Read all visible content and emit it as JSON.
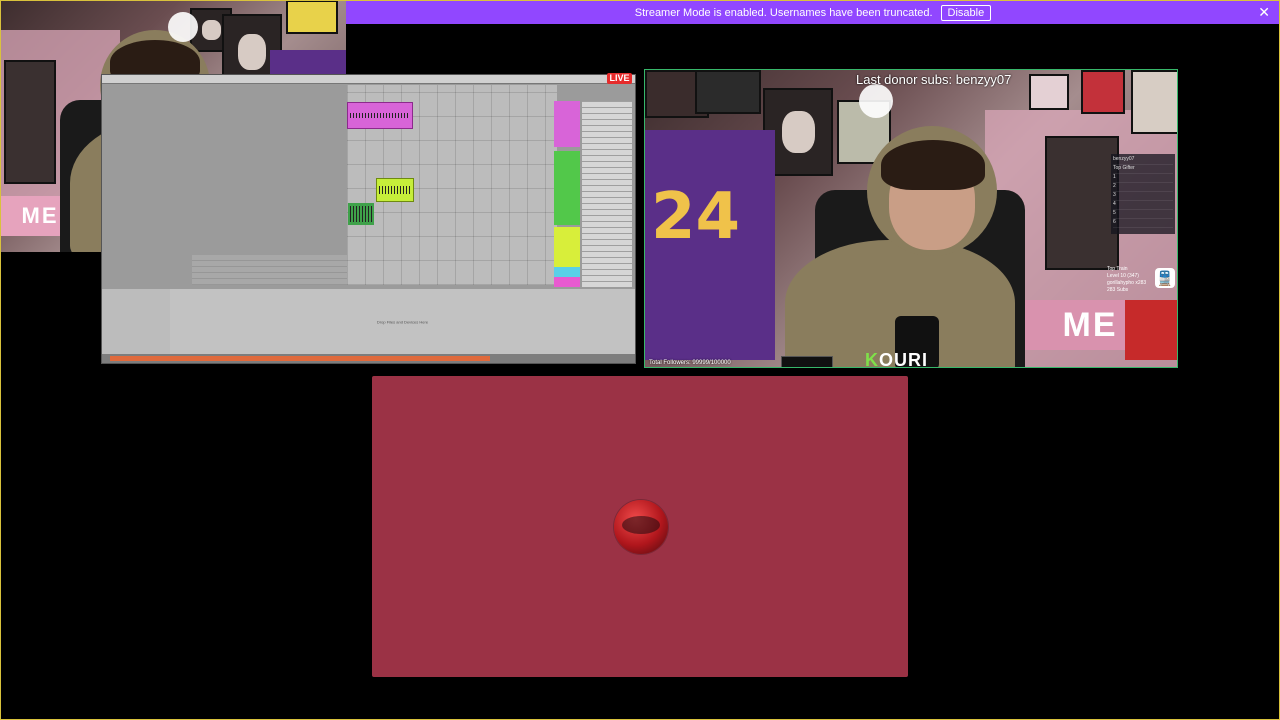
{
  "banner": {
    "message": "Streamer Mode is enabled. Usernames have been truncated.",
    "disable_label": "Disable",
    "close_icon": "✕"
  },
  "live_badge": "LIVE",
  "right_cam": {
    "donor_text": "Last donor subs: benzyy07",
    "brand_prefix": "K",
    "brand_rest": "OURI",
    "followers_text": "Total Followers: 99999/100000",
    "leaderboard_rows": [
      "benzyy07",
      "Top Gifter",
      "1",
      "2",
      "3",
      "4",
      "5",
      "6"
    ],
    "train_lines": [
      "Top Train",
      "Level 10 (347)",
      "gorillahypho x283",
      "283 Subs"
    ],
    "train_icon": "🚆"
  },
  "daw": {
    "drop_text": "Drop Files and Devices Here"
  },
  "colors": {
    "accent": "#9147ff",
    "panel_red": "#9b3245",
    "live_red": "#e62b2b",
    "border_green": "#37b86a"
  }
}
